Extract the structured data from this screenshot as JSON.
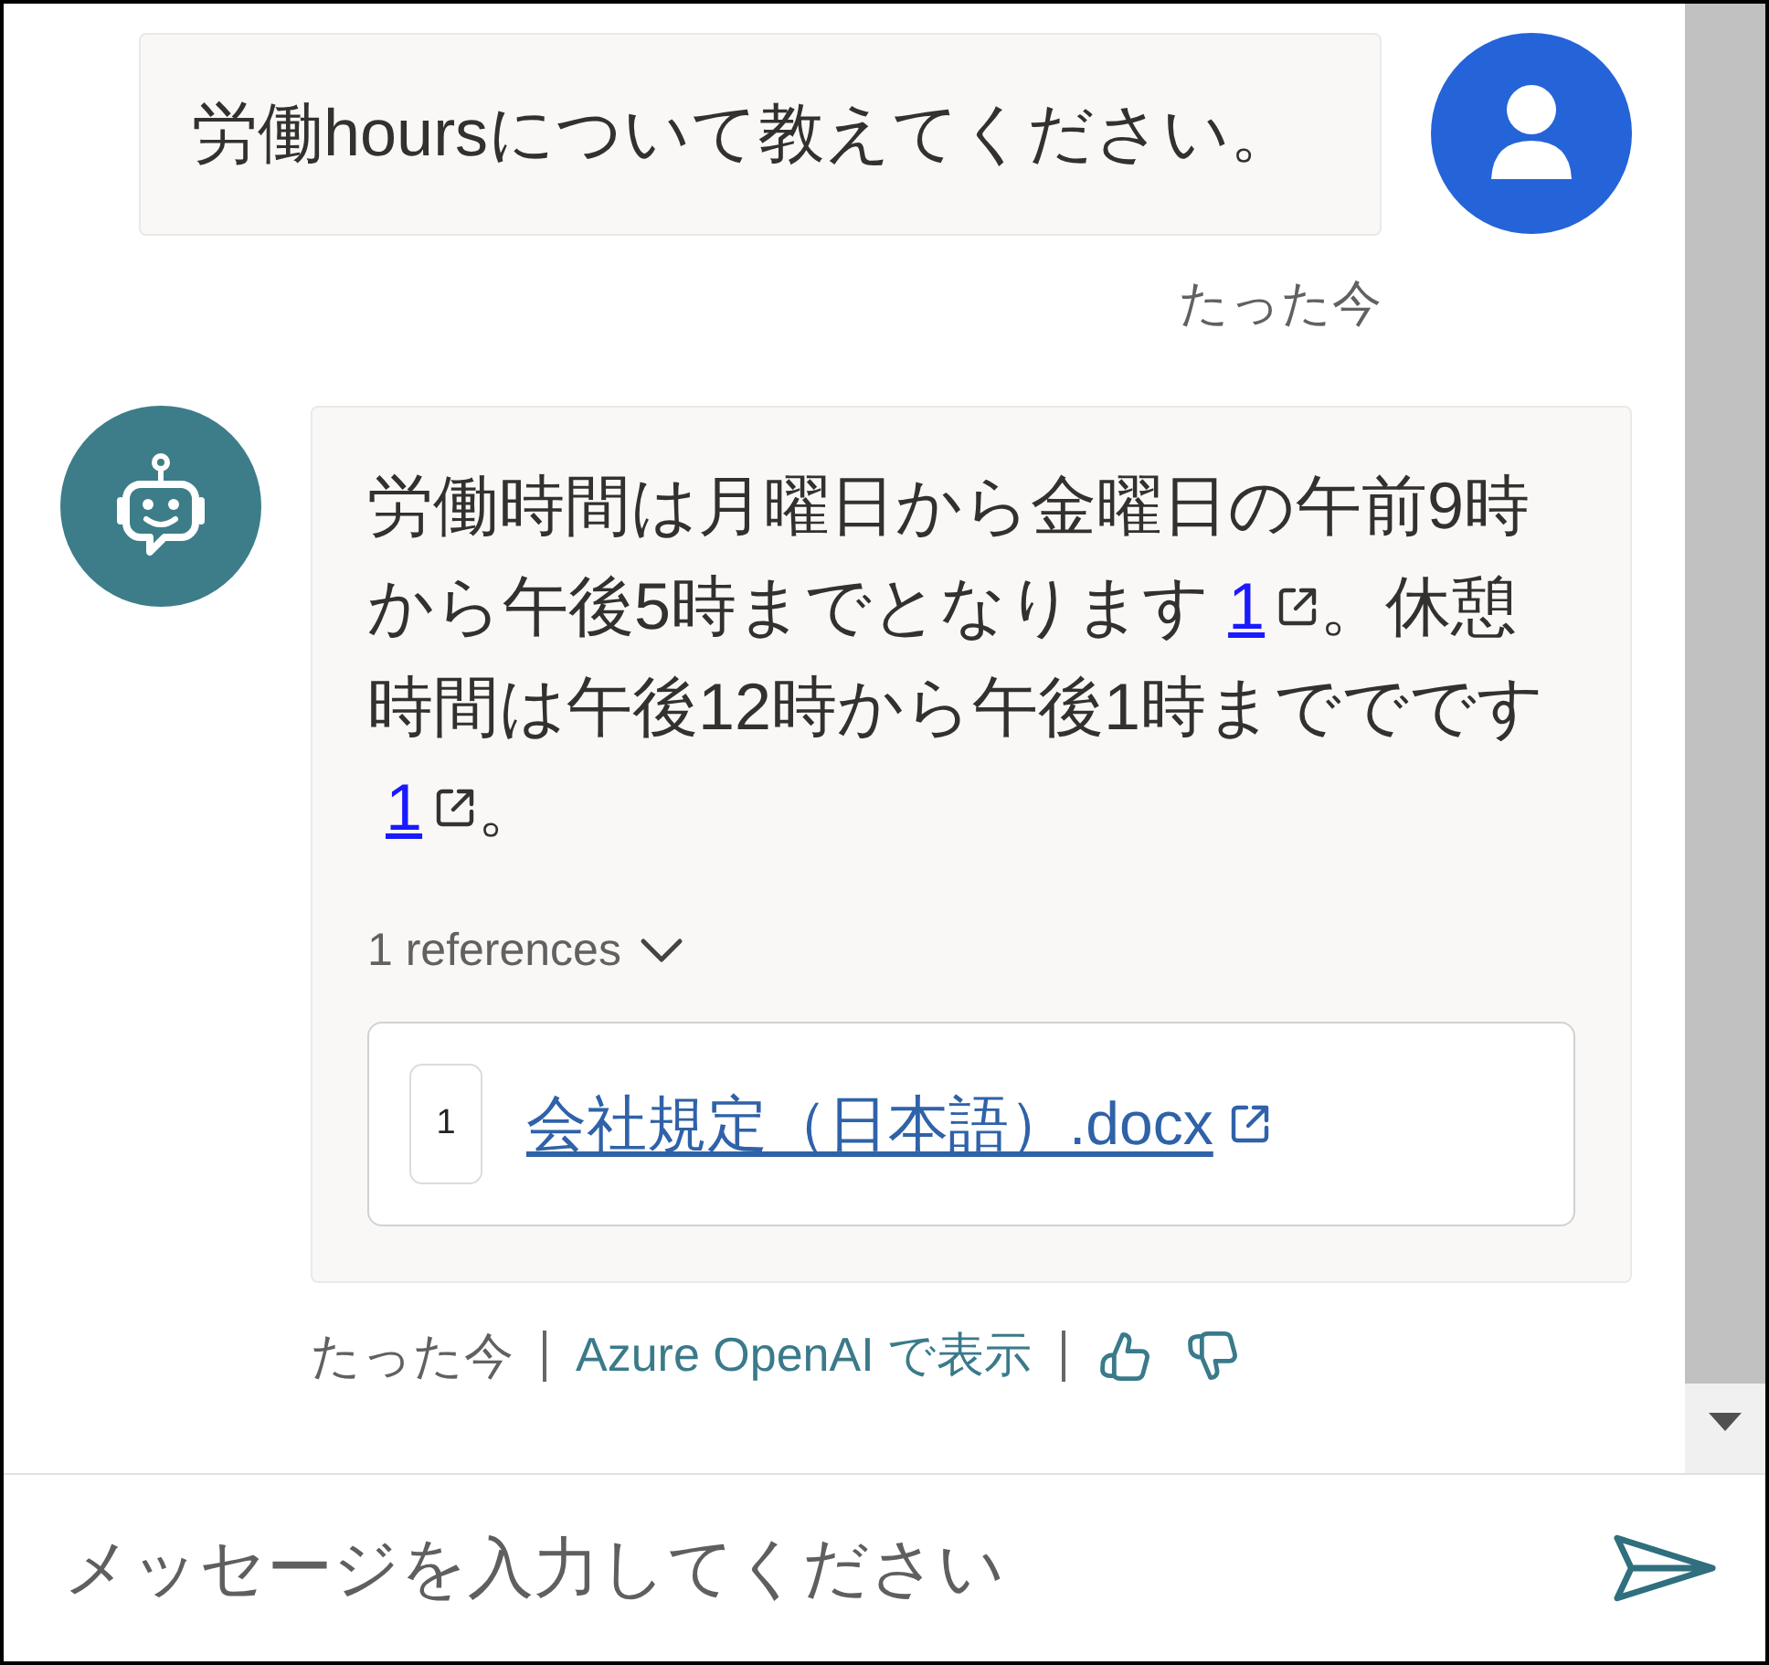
{
  "messages": [
    {
      "kind": "user",
      "text": "労働hoursについて教えてください。",
      "time": "たった今"
    },
    {
      "kind": "bot",
      "content": [
        {
          "kind": "text",
          "text": "労働時間は月曜日から金曜日の午前9時から午後5時までとなります"
        },
        {
          "kind": "citation",
          "label": "1"
        },
        {
          "kind": "text",
          "text": "。休憩時間は午後12時から午後1時まででです"
        },
        {
          "kind": "citation",
          "label": "1"
        },
        {
          "kind": "text",
          "text": "。"
        }
      ],
      "references": {
        "label": "1 references",
        "expanded": true,
        "items": [
          {
            "number": "1",
            "title": "会社規定（日本語）.docx"
          }
        ]
      },
      "time": "たった今",
      "source_link": "Azure OpenAI で表示"
    }
  ],
  "composer": {
    "placeholder": "メッセージを入力してください"
  }
}
